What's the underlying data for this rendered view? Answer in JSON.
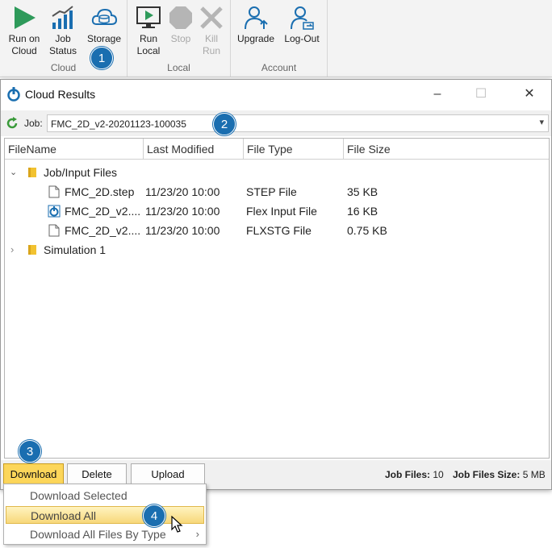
{
  "ribbon": {
    "groups": [
      {
        "name": "Cloud",
        "buttons": [
          {
            "label": "Run on Cloud",
            "line1": "Run on",
            "line2": "Cloud",
            "icon": "play-icon"
          },
          {
            "label": "Job Status",
            "line1": "Job",
            "line2": "Status",
            "icon": "bar-chart-icon"
          },
          {
            "label": "Storage",
            "line1": "Storage",
            "line2": "",
            "icon": "cloud-storage-icon"
          }
        ]
      },
      {
        "name": "Local",
        "buttons": [
          {
            "label": "Run Local",
            "line1": "Run",
            "line2": "Local",
            "icon": "monitor-play-icon"
          },
          {
            "label": "Stop",
            "line1": "Stop",
            "line2": "",
            "icon": "stop-icon",
            "disabled": true
          },
          {
            "label": "Kill Run",
            "line1": "Kill",
            "line2": "Run",
            "icon": "x-icon",
            "disabled": true
          }
        ]
      },
      {
        "name": "Account",
        "buttons": [
          {
            "label": "Upgrade",
            "line1": "Upgrade",
            "line2": "",
            "icon": "user-upgrade-icon"
          },
          {
            "label": "Log-Out",
            "line1": "Log-Out",
            "line2": "",
            "icon": "user-logout-icon"
          }
        ]
      }
    ]
  },
  "callouts": [
    "1",
    "2",
    "3",
    "4"
  ],
  "window": {
    "title": "Cloud Results",
    "controls": {
      "minimize": "–",
      "maximize": "☐",
      "close": "✕"
    }
  },
  "job": {
    "label": "Job:",
    "value": "FMC_2D_v2-20201123-100035",
    "dropdown_glyph": "▾"
  },
  "grid": {
    "columns": [
      "FileName",
      "Last Modified",
      "File Type",
      "File Size"
    ],
    "rows": [
      {
        "type": "folder",
        "expanded": true,
        "name": "Job/Input Files",
        "modified": "",
        "filetype": "",
        "size": ""
      },
      {
        "type": "file",
        "icon": "document-icon",
        "name": "FMC_2D.step",
        "modified": "11/23/20 10:00",
        "filetype": "STEP File",
        "size": "35 KB"
      },
      {
        "type": "file",
        "icon": "flex-input-icon",
        "name": "FMC_2D_v2....",
        "modified": "11/23/20 10:00",
        "filetype": "Flex Input File",
        "size": "16 KB"
      },
      {
        "type": "file",
        "icon": "document-icon",
        "name": "FMC_2D_v2....",
        "modified": "11/23/20 10:00",
        "filetype": "FLXSTG File",
        "size": "0.75 KB"
      },
      {
        "type": "folder",
        "expanded": false,
        "name": "Simulation 1",
        "modified": "",
        "filetype": "",
        "size": ""
      }
    ]
  },
  "buttons": {
    "download": "Download",
    "delete": "Delete",
    "upload": "Upload"
  },
  "status": {
    "job_files_label": "Job Files:",
    "job_files_value": "10",
    "size_label": "Job Files Size:",
    "size_value": "5 MB"
  },
  "menu": {
    "items": [
      {
        "label": "Download Selected",
        "highlighted": false
      },
      {
        "label": "Download All",
        "highlighted": true
      },
      {
        "label": "Download All Files By Type",
        "highlighted": false,
        "submenu_glyph": "›"
      }
    ]
  },
  "colors": {
    "accent_blue": "#1a6eb0",
    "play_green": "#2e9a5a",
    "download_button_bg": "#fcd65a",
    "highlight": "#f7d87a"
  }
}
